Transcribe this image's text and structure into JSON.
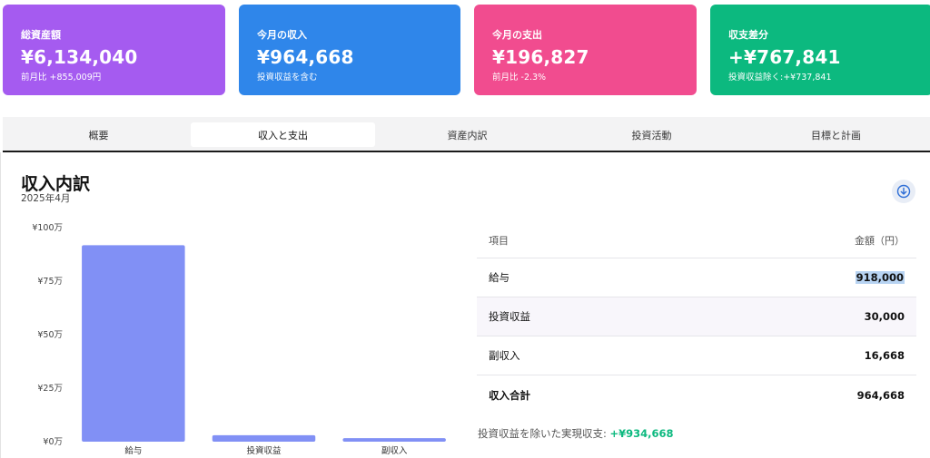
{
  "cards": [
    {
      "label": "総資産額",
      "value": "¥6,134,040",
      "sub": "前月比 +855,009円",
      "color": "#a55bf0"
    },
    {
      "label": "今月の収入",
      "value": "¥964,668",
      "sub": "投資収益を含む",
      "color": "#2f86ea"
    },
    {
      "label": "今月の支出",
      "value": "¥196,827",
      "sub": "前月比 -2.3%",
      "color": "#f14c8f"
    },
    {
      "label": "収支差分",
      "value": "+¥767,841",
      "sub": "投資収益除く:+¥737,841",
      "color": "#0cb97f"
    }
  ],
  "tabs": [
    "概要",
    "収入と支出",
    "資産内訳",
    "投資活動",
    "目標と計画"
  ],
  "active_tab": "収入と支出",
  "panel": {
    "title": "収入内訳",
    "date": "2025年4月",
    "download_icon": "download-icon"
  },
  "chart_data": {
    "type": "bar",
    "categories": [
      "給与",
      "投資収益",
      "副収入"
    ],
    "values": [
      918000,
      30000,
      16668
    ],
    "ylim": [
      0,
      1000000
    ],
    "yticks": [
      0,
      250000,
      500000,
      750000,
      1000000
    ],
    "ytick_labels": [
      "¥0万",
      "¥25万",
      "¥50万",
      "¥75万",
      "¥100万"
    ],
    "bar_color": "#8190f5",
    "grid": false,
    "legend": "none"
  },
  "table": {
    "headers": {
      "item": "項目",
      "amount": "金額（円）"
    },
    "rows": [
      {
        "item": "給与",
        "amount": "918,000"
      },
      {
        "item": "投資収益",
        "amount": "30,000"
      },
      {
        "item": "副収入",
        "amount": "16,668"
      }
    ],
    "total": {
      "item": "収入合計",
      "amount": "964,668"
    }
  },
  "summary": {
    "label": "投資収益を除いた実現収支:",
    "value": "+¥934,668"
  }
}
